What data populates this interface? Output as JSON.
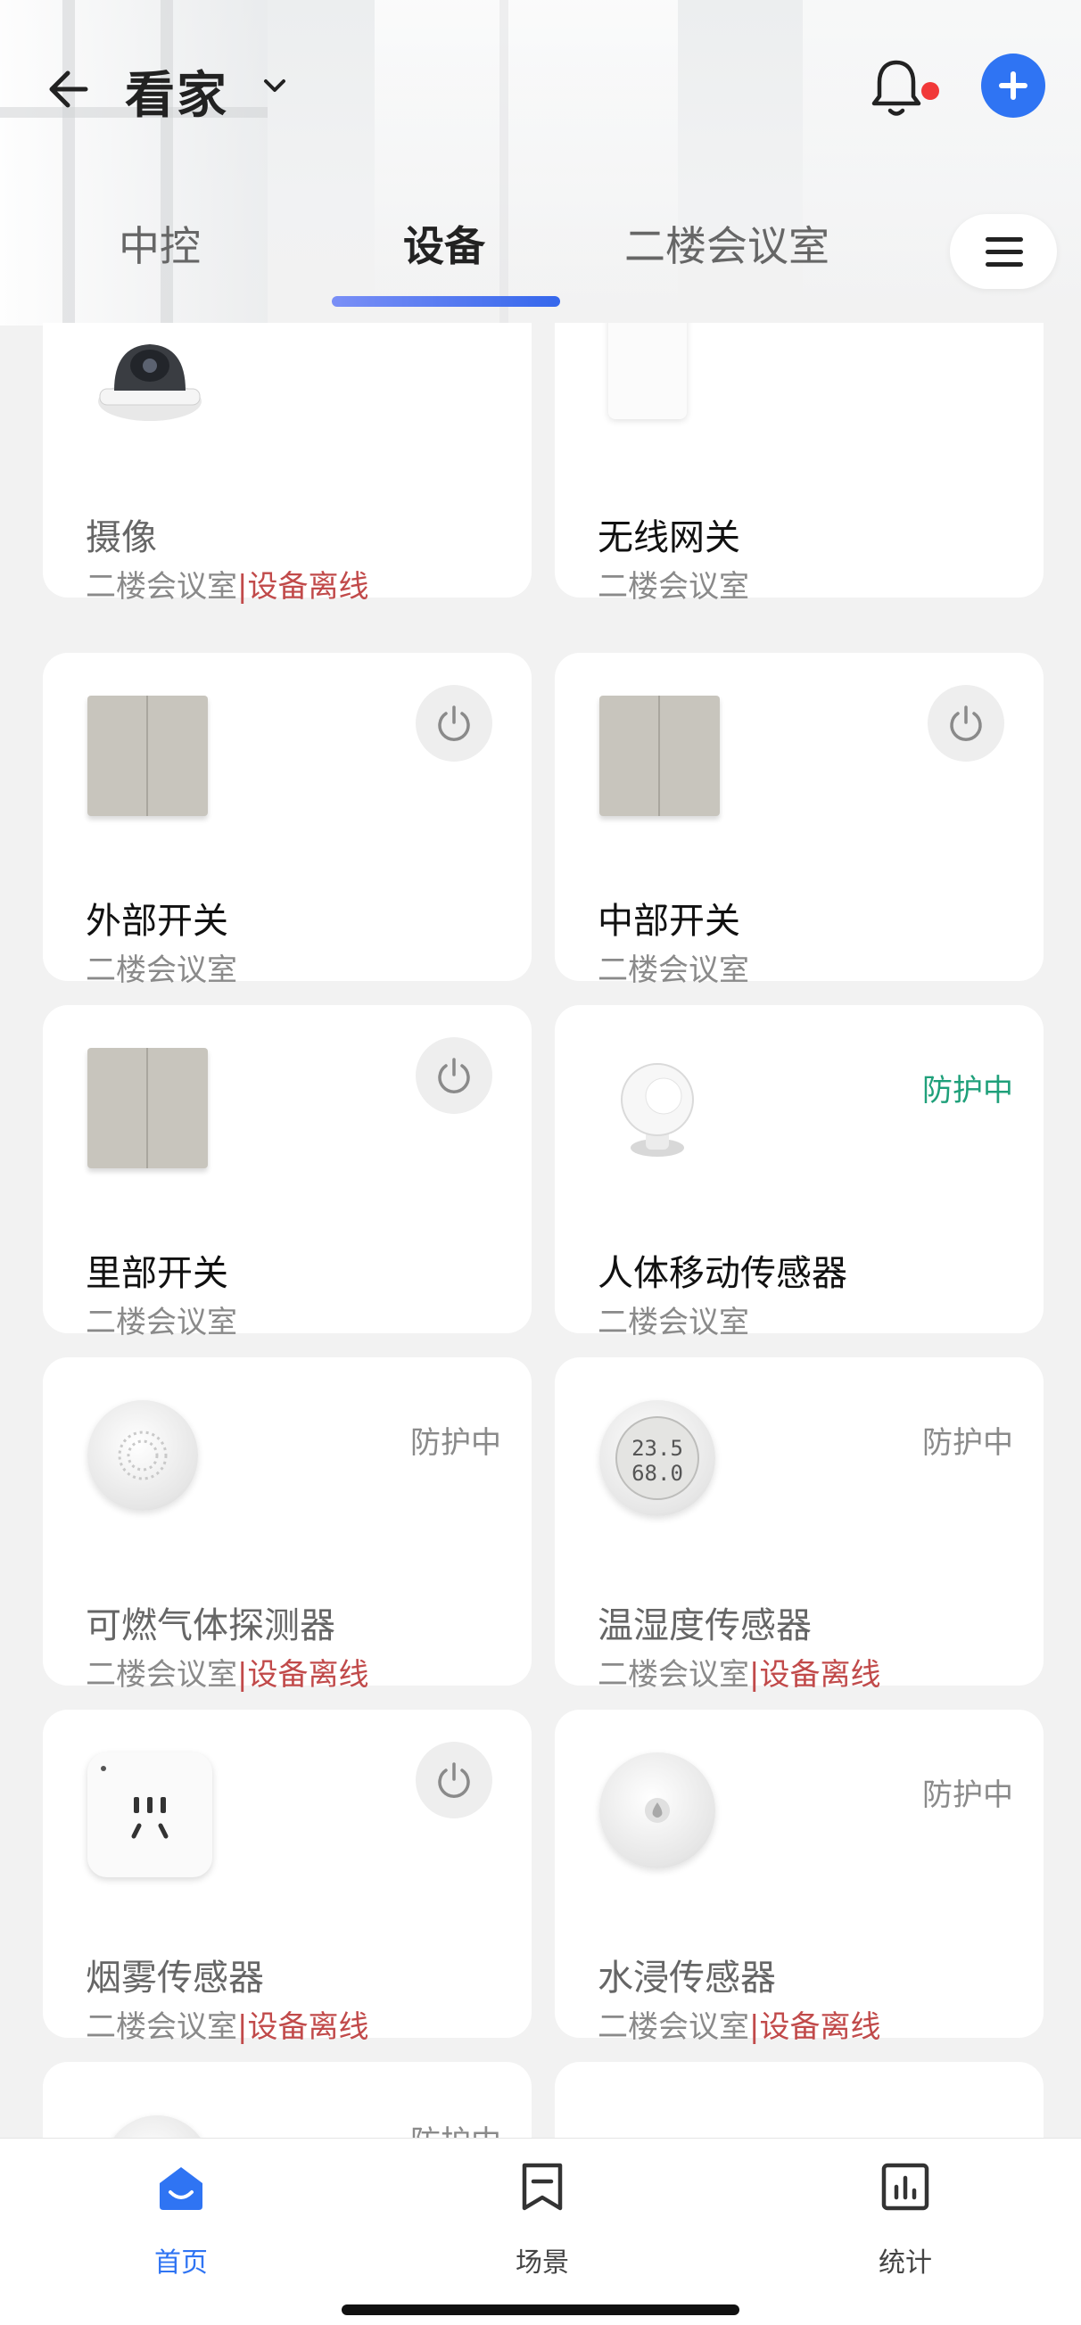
{
  "header": {
    "title": "看家"
  },
  "tabs": [
    {
      "label": "中控"
    },
    {
      "label": "设备"
    },
    {
      "label": "二楼会议室"
    }
  ],
  "devices": [
    {
      "name": "摄像",
      "room": "二楼会议室",
      "offline": "设备离线",
      "separator": "|",
      "image": "camera-icon"
    },
    {
      "name": "无线网关",
      "room": "二楼会议室",
      "image": "gateway-icon"
    },
    {
      "name": "外部开关",
      "room": "二楼会议室",
      "image": "wall-switch-icon"
    },
    {
      "name": "中部开关",
      "room": "二楼会议室",
      "image": "wall-switch-icon"
    },
    {
      "name": "里部开关",
      "room": "二楼会议室",
      "image": "wall-switch-icon"
    },
    {
      "name": "人体移动传感器",
      "room": "二楼会议室",
      "status": "防护中",
      "image": "motion-sensor-icon"
    },
    {
      "name": "可燃气体探测器",
      "room": "二楼会议室",
      "offline": "设备离线",
      "separator": "|",
      "status": "防护中",
      "image": "gas-detector-icon"
    },
    {
      "name": "温湿度传感器",
      "room": "二楼会议室",
      "offline": "设备离线",
      "separator": "|",
      "status": "防护中",
      "image": "thermo-hygrometer-icon",
      "display": {
        "temp": "23.5",
        "humidity": "68.0"
      }
    },
    {
      "name": "烟雾传感器",
      "room": "二楼会议室",
      "offline": "设备离线",
      "separator": "|",
      "image": "smart-plug-icon"
    },
    {
      "name": "水浸传感器",
      "room": "二楼会议室",
      "offline": "设备离线",
      "separator": "|",
      "status": "防护中",
      "image": "water-sensor-icon"
    },
    {
      "status": "防护中"
    }
  ],
  "bottom_nav": [
    {
      "label": "首页",
      "icon": "home-icon",
      "active": true
    },
    {
      "label": "场景",
      "icon": "scene-icon"
    },
    {
      "label": "统计",
      "icon": "stats-icon"
    }
  ],
  "colors": {
    "accent": "#2f74f3",
    "offline": "#c14a4a",
    "protecting": "#1fa07a",
    "notification_dot": "#f13838"
  }
}
